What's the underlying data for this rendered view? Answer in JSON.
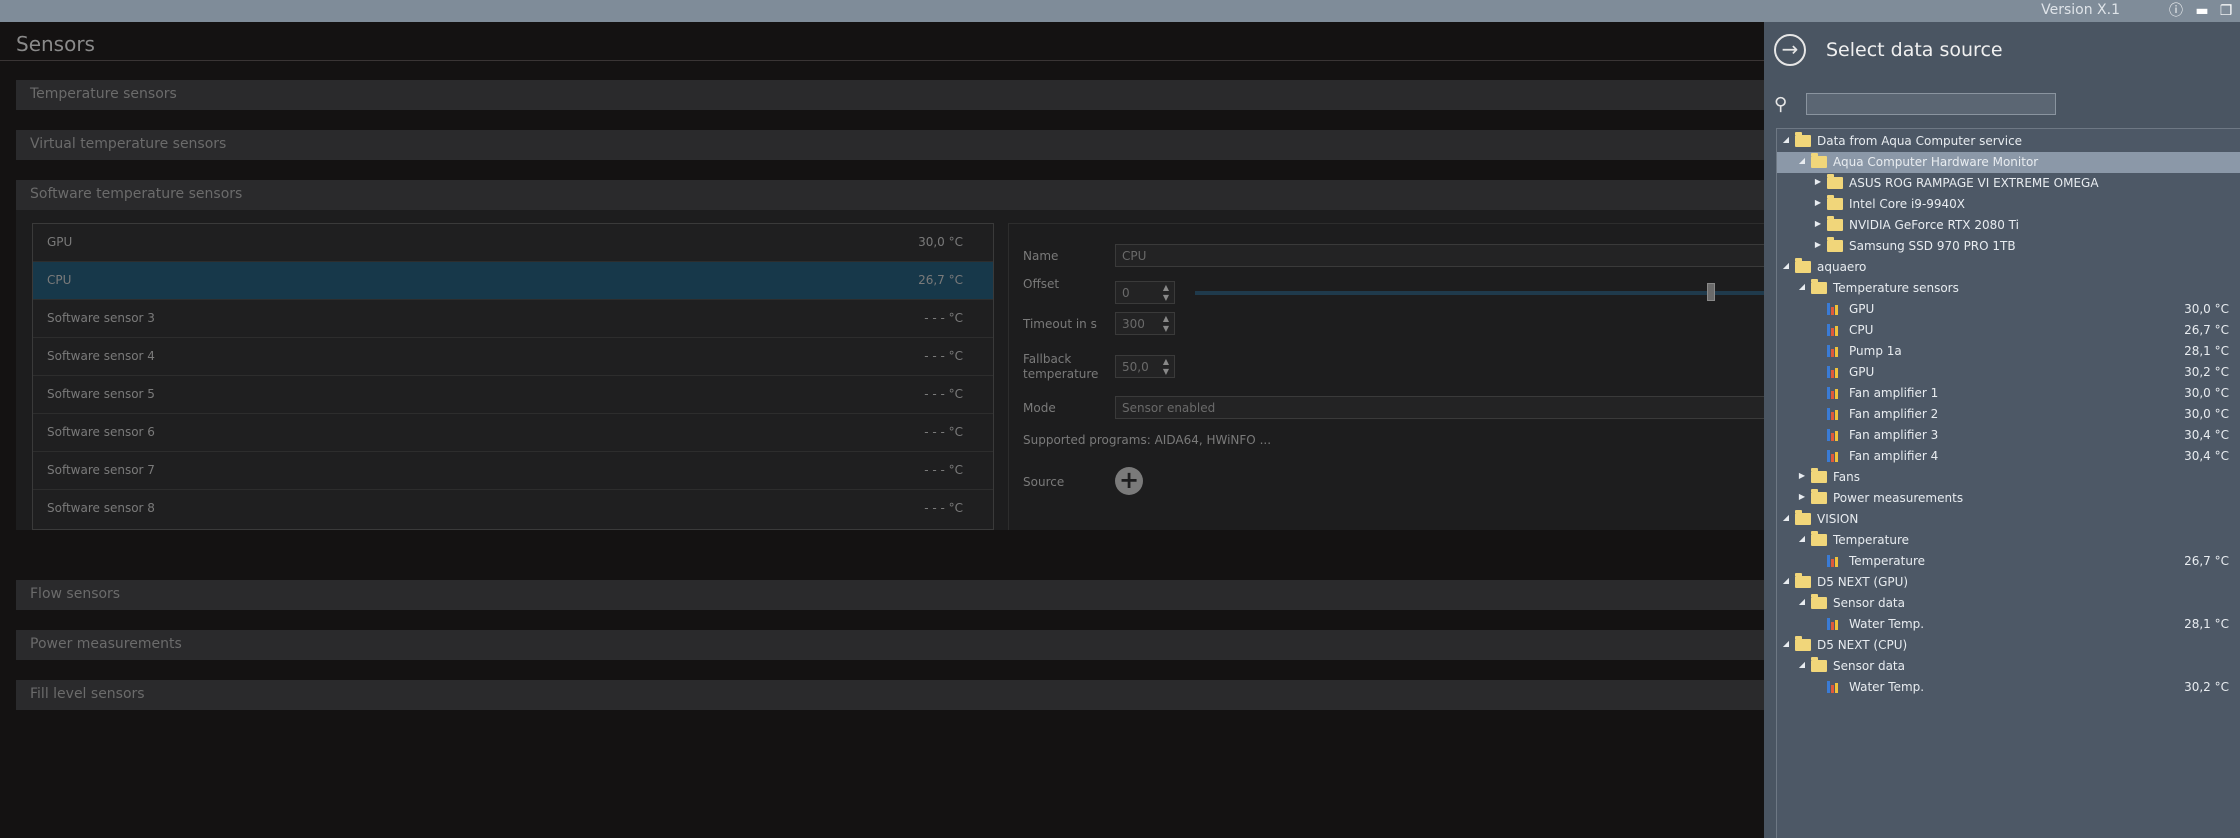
{
  "topbar": {
    "version": "Version X.1"
  },
  "main": {
    "title": "Sensors",
    "sections": [
      {
        "label": "Temperature sensors"
      },
      {
        "label": "Virtual temperature sensors"
      },
      {
        "label": "Software temperature sensors"
      },
      {
        "label": "Flow sensors"
      },
      {
        "label": "Power measurements"
      },
      {
        "label": "Fill level sensors"
      }
    ],
    "software_sensors": [
      {
        "name": "GPU",
        "value": "30,0 °C"
      },
      {
        "name": "CPU",
        "value": "26,7 °C",
        "selected": true
      },
      {
        "name": "Software sensor 3",
        "value": "- - - °C"
      },
      {
        "name": "Software sensor 4",
        "value": "- - - °C"
      },
      {
        "name": "Software sensor 5",
        "value": "- - - °C"
      },
      {
        "name": "Software sensor 6",
        "value": "- - - °C"
      },
      {
        "name": "Software sensor 7",
        "value": "- - - °C"
      },
      {
        "name": "Software sensor 8",
        "value": "- - - °C"
      }
    ],
    "detail": {
      "name_label": "Name",
      "name_value": "CPU",
      "offset_label": "Offset",
      "offset_value": "0",
      "timeout_label": "Timeout in s",
      "timeout_value": "300",
      "fallback_label_1": "Fallback",
      "fallback_label_2": "temperature",
      "fallback_value": "50,0",
      "mode_label": "Mode",
      "mode_value": "Sensor enabled",
      "supported": "Supported programs: AIDA64, HWiNFO ...",
      "source_label": "Source"
    }
  },
  "datasource": {
    "title": "Select data source",
    "search_placeholder": "",
    "tree": [
      {
        "label": "Data from Aqua Computer service",
        "level": 0,
        "kind": "folder",
        "expanded": true
      },
      {
        "label": "Aqua Computer Hardware Monitor",
        "level": 1,
        "kind": "folder",
        "expanded": true,
        "selected": true
      },
      {
        "label": "ASUS ROG RAMPAGE VI EXTREME OMEGA",
        "level": 2,
        "kind": "folder",
        "expanded": false
      },
      {
        "label": "Intel Core i9-9940X",
        "level": 2,
        "kind": "folder",
        "expanded": false
      },
      {
        "label": "NVIDIA GeForce RTX 2080 Ti",
        "level": 2,
        "kind": "folder",
        "expanded": false
      },
      {
        "label": "Samsung SSD 970 PRO 1TB",
        "level": 2,
        "kind": "folder",
        "expanded": false
      },
      {
        "label": "aquaero",
        "level": 0,
        "kind": "folder",
        "expanded": true
      },
      {
        "label": "Temperature sensors",
        "level": 1,
        "kind": "folder",
        "expanded": true
      },
      {
        "label": "GPU",
        "level": 2,
        "kind": "sensor",
        "value": "30,0 °C"
      },
      {
        "label": "CPU",
        "level": 2,
        "kind": "sensor",
        "value": "26,7 °C"
      },
      {
        "label": "Pump 1a",
        "level": 2,
        "kind": "sensor",
        "value": "28,1 °C"
      },
      {
        "label": "GPU",
        "level": 2,
        "kind": "sensor",
        "value": "30,2 °C"
      },
      {
        "label": "Fan amplifier 1",
        "level": 2,
        "kind": "sensor",
        "value": "30,0 °C"
      },
      {
        "label": "Fan amplifier 2",
        "level": 2,
        "kind": "sensor",
        "value": "30,0 °C"
      },
      {
        "label": "Fan amplifier 3",
        "level": 2,
        "kind": "sensor",
        "value": "30,4 °C"
      },
      {
        "label": "Fan amplifier 4",
        "level": 2,
        "kind": "sensor",
        "value": "30,4 °C"
      },
      {
        "label": "Fans",
        "level": 1,
        "kind": "folder",
        "expanded": false
      },
      {
        "label": "Power measurements",
        "level": 1,
        "kind": "folder",
        "expanded": false
      },
      {
        "label": "VISION",
        "level": 0,
        "kind": "folder",
        "expanded": true
      },
      {
        "label": "Temperature",
        "level": 1,
        "kind": "folder",
        "expanded": true
      },
      {
        "label": "Temperature",
        "level": 2,
        "kind": "sensor",
        "value": "26,7 °C"
      },
      {
        "label": "D5 NEXT (GPU)",
        "level": 0,
        "kind": "folder",
        "expanded": true
      },
      {
        "label": "Sensor data",
        "level": 1,
        "kind": "folder",
        "expanded": true
      },
      {
        "label": "Water Temp.",
        "level": 2,
        "kind": "sensor",
        "value": "28,1 °C"
      },
      {
        "label": "D5 NEXT (CPU)",
        "level": 0,
        "kind": "folder",
        "expanded": true
      },
      {
        "label": "Sensor data",
        "level": 1,
        "kind": "folder",
        "expanded": true
      },
      {
        "label": "Water Temp.",
        "level": 2,
        "kind": "sensor",
        "value": "30,2 °C"
      }
    ]
  },
  "colors": {
    "accent": "#17384a",
    "folder": "#f1d67a",
    "panel": "#4a5562"
  }
}
